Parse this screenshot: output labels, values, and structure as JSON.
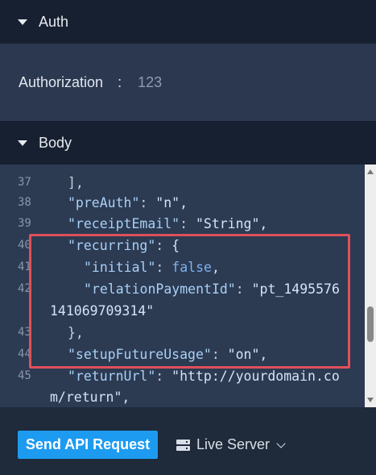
{
  "auth": {
    "header_label": "Auth",
    "field_label": "Authorization",
    "separator": ":",
    "field_value": "123"
  },
  "body": {
    "header_label": "Body",
    "code_lines": [
      {
        "num": "37",
        "text": "],"
      },
      {
        "num": "38",
        "text": "\"preAuth\": \"n\","
      },
      {
        "num": "39",
        "text": "\"receiptEmail\": \"String\","
      },
      {
        "num": "40",
        "text": "\"recurring\": {"
      },
      {
        "num": "41",
        "text": "\"initial\": false,"
      },
      {
        "num": "42",
        "text": "\"relationPaymentId\": \"pt_1495576"
      },
      {
        "num": "",
        "text": "141069709314\""
      },
      {
        "num": "43",
        "text": "},"
      },
      {
        "num": "44",
        "text": "\"setupFutureUsage\": \"on\","
      },
      {
        "num": "45",
        "text": "\"returnUrl\": \"http://yourdomain.co"
      },
      {
        "num": "",
        "text": "m/return\","
      }
    ]
  },
  "footer": {
    "send_label": "Send API Request",
    "server_label": "Live Server"
  },
  "colors": {
    "accent": "#1d9bf0",
    "highlight_border": "#e0505a"
  },
  "icons": [
    "triangle-down-icon",
    "server-icon",
    "chevron-down-icon",
    "scroll-up-icon",
    "scroll-down-icon"
  ]
}
